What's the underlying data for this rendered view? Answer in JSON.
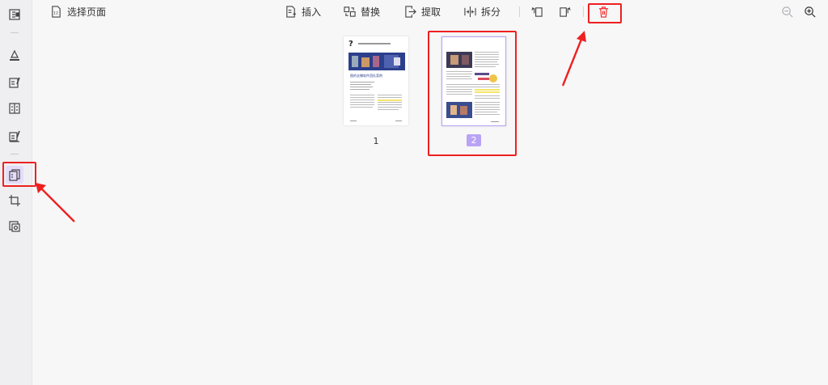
{
  "toolbar": {
    "select_page_label": "选择页面",
    "insert_label": "插入",
    "replace_label": "替换",
    "extract_label": "提取",
    "split_label": "拆分"
  },
  "pages": [
    {
      "number": "1",
      "selected": false
    },
    {
      "number": "2",
      "selected": true
    }
  ],
  "page1": {
    "headline": "图的支撑软件团队案例"
  },
  "colors": {
    "accent": "#b9a3f5",
    "annotation": "#ee2020",
    "background": "#f7f7f8"
  },
  "icons": {
    "rail": [
      "page-view-icon",
      "highlighter-icon",
      "edit-icon",
      "form-icon",
      "sign-icon",
      "organize-pages-icon",
      "crop-icon",
      "layers-icon"
    ],
    "toolbar": [
      "select-page-icon",
      "insert-icon",
      "replace-icon",
      "extract-icon",
      "split-icon",
      "rotate-left-icon",
      "rotate-right-icon",
      "delete-icon",
      "zoom-out-icon",
      "zoom-in-icon"
    ]
  }
}
